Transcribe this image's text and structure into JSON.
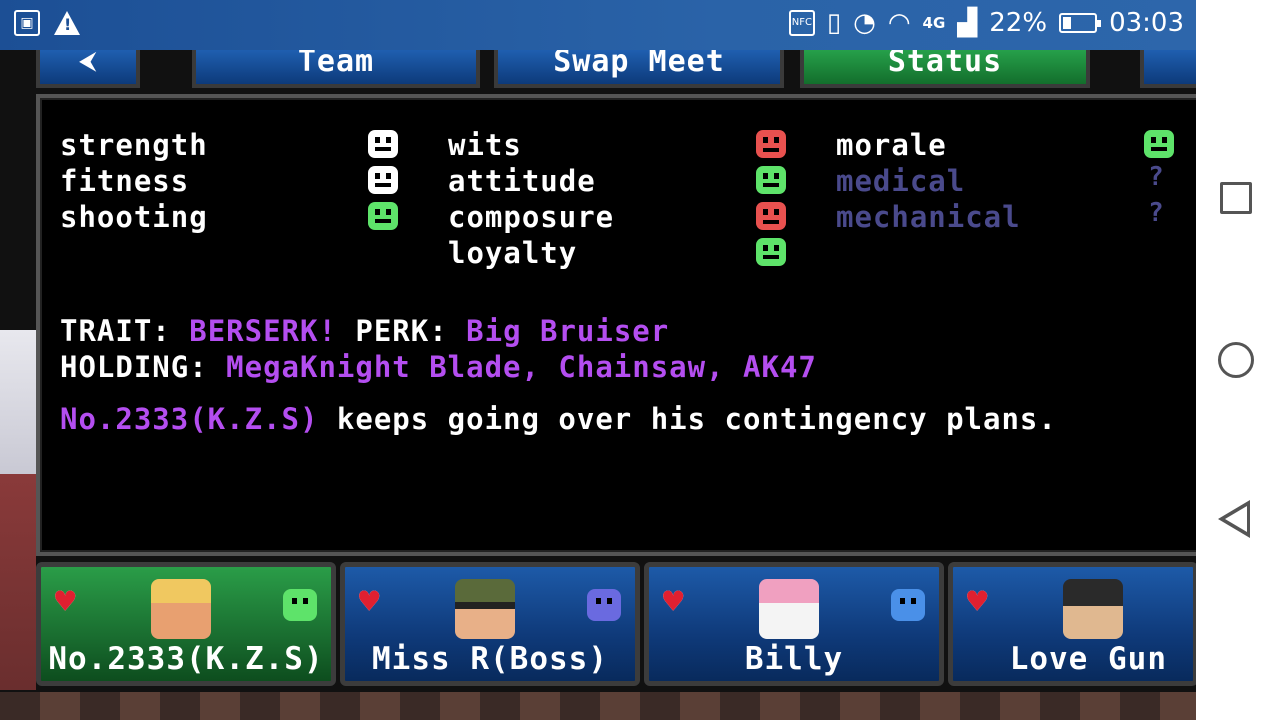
{
  "status_bar": {
    "battery": "22%",
    "time": "03:03",
    "network": "4G",
    "icons": [
      "gallery-icon",
      "warning-icon",
      "nfc-icon",
      "vibrate-icon",
      "alarm-icon",
      "wifi-icon",
      "signal-icon",
      "battery-icon"
    ]
  },
  "tabs": [
    {
      "label": "Team",
      "color": "#1f5fb0"
    },
    {
      "label": "Swap Meet",
      "color": "#1f5fb0"
    },
    {
      "label": "Status",
      "color": "#26a04a"
    }
  ],
  "stats": {
    "col1": [
      {
        "label": "strength",
        "mood": "white"
      },
      {
        "label": "fitness",
        "mood": "white"
      },
      {
        "label": "shooting",
        "mood": "green"
      }
    ],
    "col2": [
      {
        "label": "wits",
        "mood": "red"
      },
      {
        "label": "attitude",
        "mood": "green"
      },
      {
        "label": "composure",
        "mood": "red"
      },
      {
        "label": "loyalty",
        "mood": "green"
      }
    ],
    "col3": [
      {
        "label": "morale",
        "mood": "green"
      },
      {
        "label": "medical",
        "mood": "?"
      },
      {
        "label": "mechanical",
        "mood": "?"
      }
    ]
  },
  "info": {
    "trait_label": "TRAIT:",
    "trait_value": "BERSERK!",
    "perk_label": "PERK:",
    "perk_value": "Big Bruiser",
    "holding_label": "HOLDING:",
    "holding_value": "MegaKnight Blade, Chainsaw, AK47",
    "character_name": "No.2333(K.Z.S)",
    "message": "keeps going over his contingency plans."
  },
  "roster": [
    {
      "name": "No.2333(K.Z.S)",
      "mood": "green",
      "selected": true
    },
    {
      "name": "Miss R(Boss)",
      "mood": "blue",
      "selected": false
    },
    {
      "name": "Billy",
      "mood": "blue",
      "selected": false
    },
    {
      "name": "Love Gun",
      "mood": "green",
      "selected": false
    }
  ],
  "colors": {
    "accent_purple": "#b44ef0",
    "dim_text": "#4a4a8c",
    "happy_green": "#5ee36a",
    "sad_red": "#e8514f"
  }
}
